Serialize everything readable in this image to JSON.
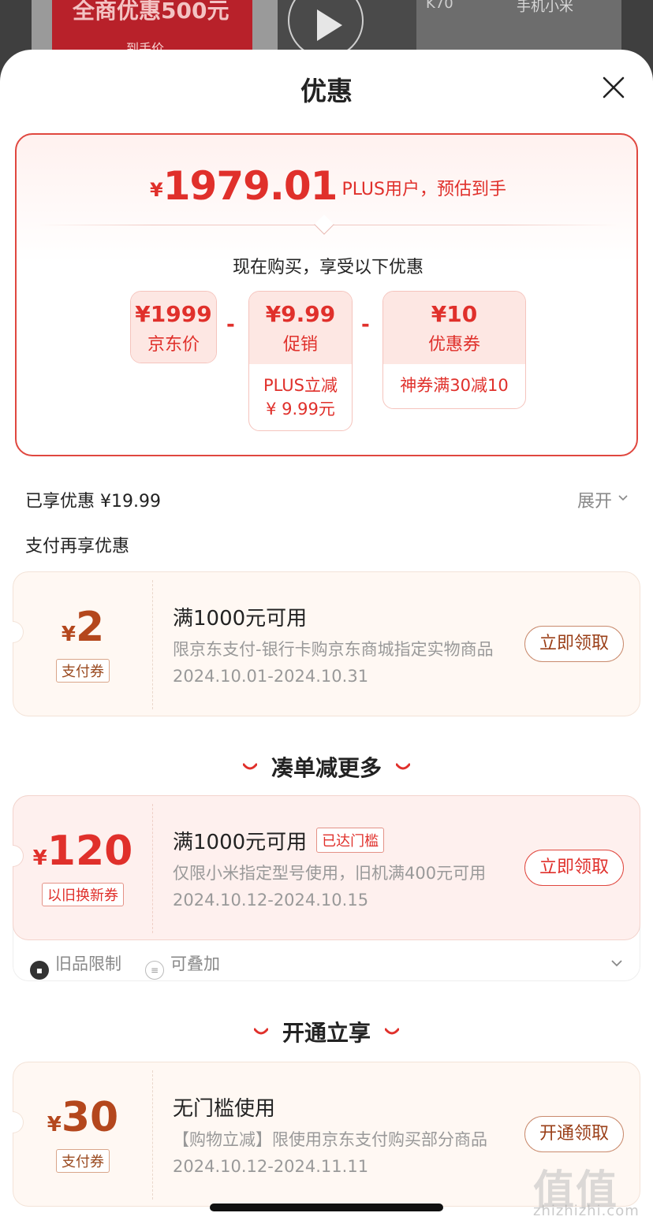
{
  "background": {
    "promo_text": "全商优惠500元",
    "promo_sub": "到手价",
    "model": "K70",
    "category": "手机小米"
  },
  "sheet": {
    "title": "优惠"
  },
  "price_card": {
    "currency": "¥",
    "price": "1979.01",
    "note": "PLUS用户，预估到手",
    "buy_now": "现在购买，享受以下优惠",
    "minus": "-",
    "breakdown": [
      {
        "amount": "¥1999",
        "label": "京东价"
      },
      {
        "amount": "¥9.99",
        "label": "促销",
        "detail_line1": "PLUS立减",
        "detail_line2": "¥ 9.99元"
      },
      {
        "amount": "¥10",
        "label": "优惠券",
        "detail_line1": "神券满30减10"
      }
    ]
  },
  "summary": {
    "enjoyed": "已享优惠 ¥19.99",
    "expand": "展开",
    "pay_more": "支付再享优惠"
  },
  "coupons": [
    {
      "currency": "¥",
      "amount": "2",
      "tag": "支付券",
      "title": "满1000元可用",
      "desc": "限京东支付-银行卡购京东商城指定实物商品",
      "date": "2024.10.01-2024.10.31",
      "button": "立即领取"
    },
    {
      "currency": "¥",
      "amount": "120",
      "tag": "以旧换新券",
      "title": "满1000元可用",
      "badge": "已达门槛",
      "desc": "仅限小米指定型号使用，旧机满400元可用",
      "date": "2024.10.12-2024.10.15",
      "button": "立即领取",
      "features": [
        "旧品限制",
        "可叠加"
      ]
    },
    {
      "currency": "¥",
      "amount": "30",
      "tag": "支付券",
      "title": "无门槛使用",
      "desc": "【购物立减】限使用京东支付购买部分商品",
      "date": "2024.10.12-2024.11.11",
      "button": "开通领取"
    }
  ],
  "sections": {
    "combine": "凑单减更多",
    "activate": "开通立享"
  },
  "watermark": {
    "main": "值值值",
    "sub": "zhizhizhi.com"
  },
  "colors": {
    "accent_red": "#e0302b",
    "brown": "#b4471d",
    "card_border": "#e0473f"
  }
}
